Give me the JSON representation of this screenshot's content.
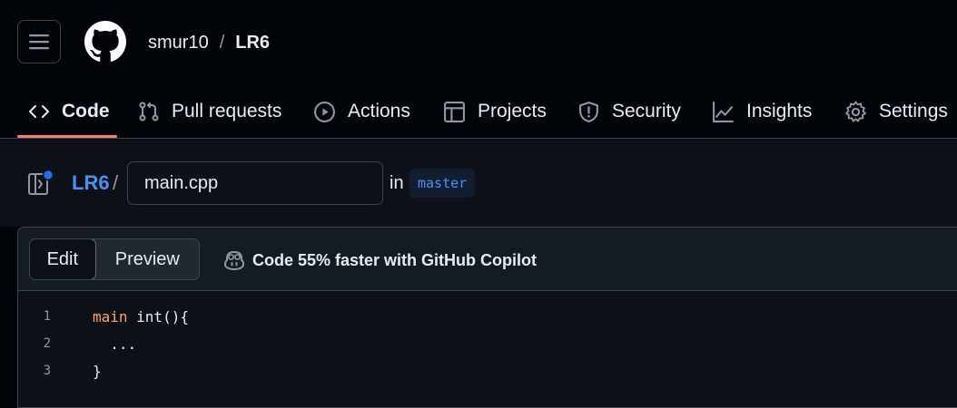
{
  "header": {
    "owner": "smur10",
    "separator": "/",
    "repo": "LR6"
  },
  "nav": {
    "tabs": [
      {
        "label": "Code",
        "icon": "code-icon",
        "selected": true
      },
      {
        "label": "Pull requests",
        "icon": "git-pull-request-icon"
      },
      {
        "label": "Actions",
        "icon": "play-icon"
      },
      {
        "label": "Projects",
        "icon": "table-icon"
      },
      {
        "label": "Security",
        "icon": "shield-icon"
      },
      {
        "label": "Insights",
        "icon": "graph-icon"
      },
      {
        "label": "Settings",
        "icon": "gear-icon"
      }
    ]
  },
  "path": {
    "repo": "LR6",
    "separator": "/",
    "filename": "main.cpp",
    "in_label": "in",
    "branch": "master"
  },
  "editor": {
    "edit_label": "Edit",
    "preview_label": "Preview",
    "copilot_text": "Code 55% faster with GitHub Copilot",
    "lines": [
      {
        "number": "1",
        "keyword": "main",
        "rest": " int(){"
      },
      {
        "number": "2",
        "keyword": "",
        "rest": "  ..."
      },
      {
        "number": "3",
        "keyword": "",
        "rest": "}"
      }
    ]
  },
  "colors": {
    "background": "#010409",
    "link": "#4493f8",
    "tab_underline": "#f78166",
    "keyword": "#ffa657"
  }
}
